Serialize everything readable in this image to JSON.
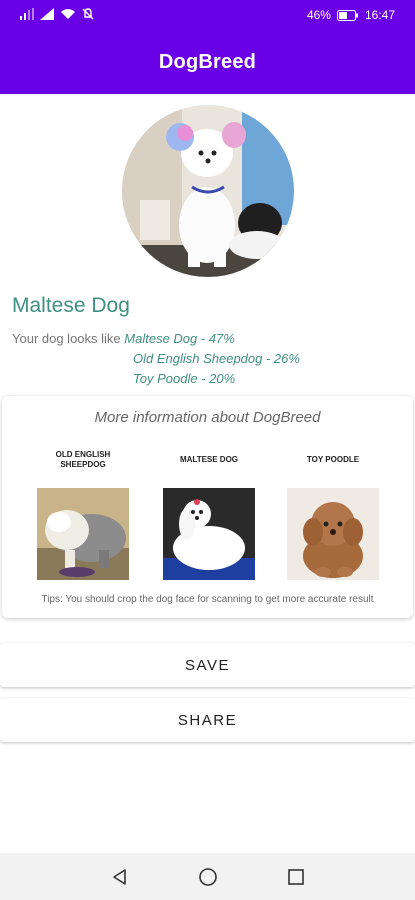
{
  "status_bar": {
    "battery": "46%",
    "time": "16:47"
  },
  "app_bar": {
    "title": "DogBreed"
  },
  "result": {
    "breed_name": "Maltese Dog",
    "intro": "Your dog looks like",
    "predictions": [
      "Maltese Dog - 47%",
      "Old English Sheepdog - 26%",
      "Toy Poodle - 20%"
    ]
  },
  "info_card": {
    "title": "More information about DogBreed",
    "breeds": [
      {
        "label": "OLD ENGLISH SHEEPDOG",
        "icon": "sheepdog-photo"
      },
      {
        "label": "MALTESE DOG",
        "icon": "maltese-photo"
      },
      {
        "label": "TOY POODLE",
        "icon": "poodle-photo"
      }
    ],
    "tips": "Tips: You should crop the dog face for scanning to get more accurate result"
  },
  "actions": {
    "save_label": "SAVE",
    "share_label": "SHARE"
  },
  "colors": {
    "primary": "#6a00e6",
    "accent_text": "#3f8f83"
  }
}
